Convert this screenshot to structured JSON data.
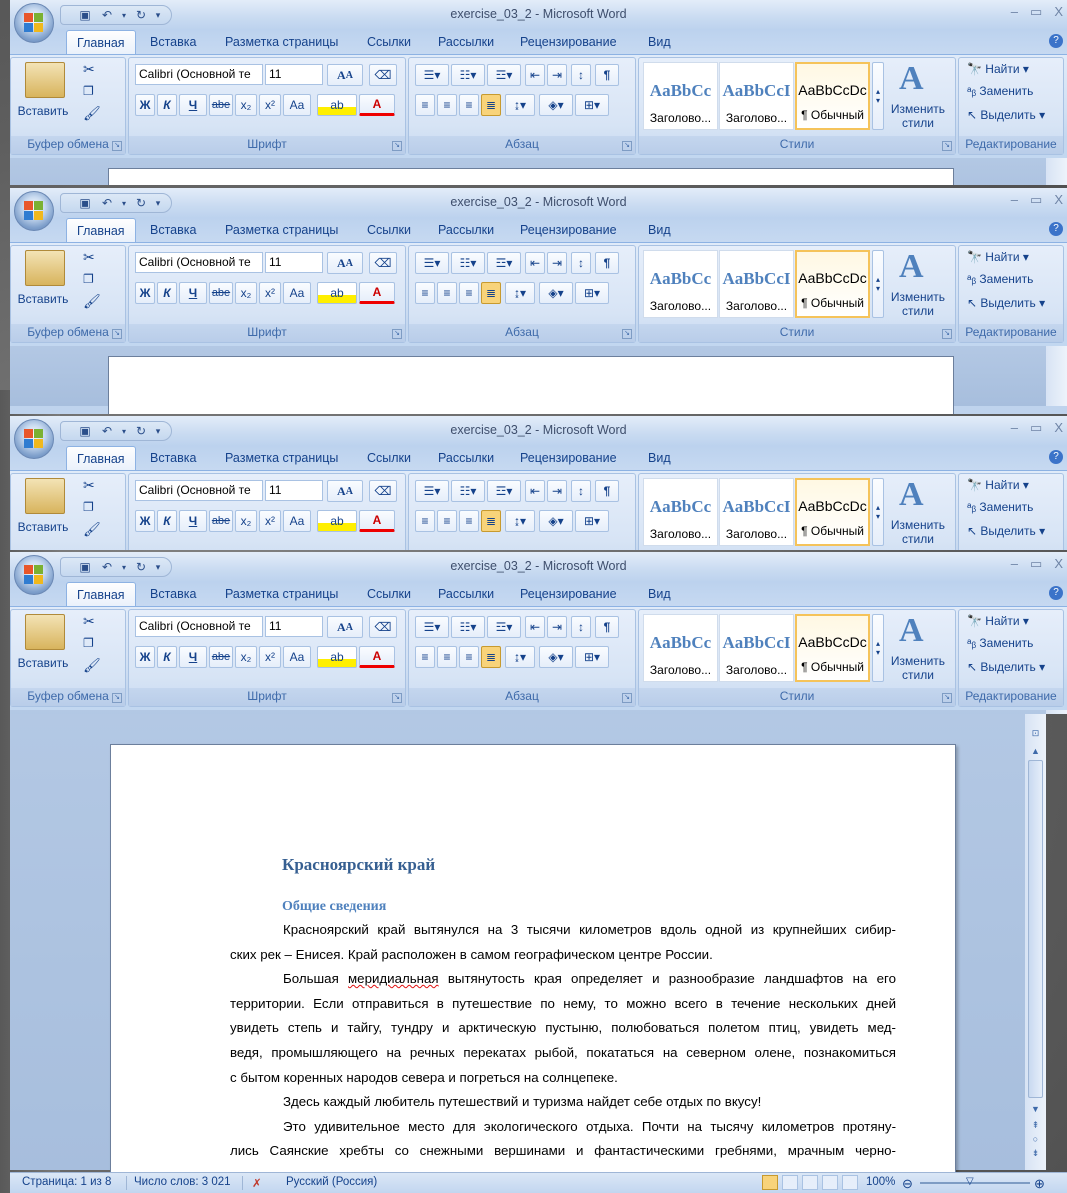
{
  "app": {
    "title": "exercise_03_2 - Microsoft Word",
    "window_controls": [
      "–",
      "▭",
      "X"
    ]
  },
  "tabs": [
    "Главная",
    "Вставка",
    "Разметка страницы",
    "Ссылки",
    "Рассылки",
    "Рецензирование",
    "Вид"
  ],
  "clipboard": {
    "paste_label": "Вставить",
    "group_label": "Буфер обмена"
  },
  "font": {
    "font_name": "Calibri (Основной те",
    "font_size": "11",
    "group_label": "Шрифт",
    "bold": "Ж",
    "italic": "К",
    "underline": "Ч",
    "strike": "abe",
    "subscript": "x₂",
    "superscript": "x²",
    "change_case": "Aa",
    "grow": "A",
    "shrink": "A",
    "font_color": "A",
    "highlight": "ab"
  },
  "paragraph": {
    "group_label": "Абзац",
    "pilcrow": "¶"
  },
  "styles": {
    "group_label": "Стили",
    "items": [
      {
        "sample": "AaBbCc",
        "name": "Заголово..."
      },
      {
        "sample": "AaBbCcI",
        "name": "Заголово..."
      },
      {
        "sample": "AaBbCcDc",
        "name": "¶ Обычный"
      }
    ],
    "change_label_1": "Изменить",
    "change_label_2": "стили",
    "change_label_short": "Изменить"
  },
  "editing": {
    "group_label": "Редактирование",
    "find": "Найти",
    "replace": "Заменить",
    "select": "Выделить"
  },
  "document": {
    "heading": "Красноярский край",
    "subheading": "Общие сведения",
    "p1_l1": "Красноярский край вытянулся на 3 тысячи километров вдоль одной из крупнейших сибир-",
    "p1_l2": "ских рек – Енисея. Край расположен в самом географическом центре России.",
    "p2_l1a": "Большая ",
    "p2_l1b": "меридиальная",
    "p2_l1c": " вытянутость края определяет и разнообразие ландшафтов на его",
    "p2_l2": "территории. Если отправиться в путешествие по нему, то можно всего в течение нескольких дней",
    "p2_l3": "увидеть степь и тайгу, тундру и арктическую пустыню, полюбоваться полетом птиц, увидеть мед-",
    "p2_l4": "ведя, промышляющего на речных перекатах рыбой, покататься на северном олене, познакомиться",
    "p2_l5": "с бытом коренных народов севера и погреться на солнцепеке.",
    "p3": "Здесь каждый любитель путешествий и туризма найдет себе отдых по вкусу!",
    "p4_l1": "Это удивительное место для экологического отдыха. Почти на тысячу километров протяну-",
    "p4_l2": "лись Саянские хребты со снежными вершинами и фантастическими гребнями, мрачным черно-"
  },
  "status": {
    "page": "Страница: 1 из 8",
    "words": "Число слов: 3 021",
    "language": "Русский (Россия)",
    "zoom": "100%"
  },
  "colors": {
    "ribbon": "#d1e0f3",
    "tab_text": "#15428b",
    "heading": "#365f91",
    "subheading": "#4f81bd"
  }
}
